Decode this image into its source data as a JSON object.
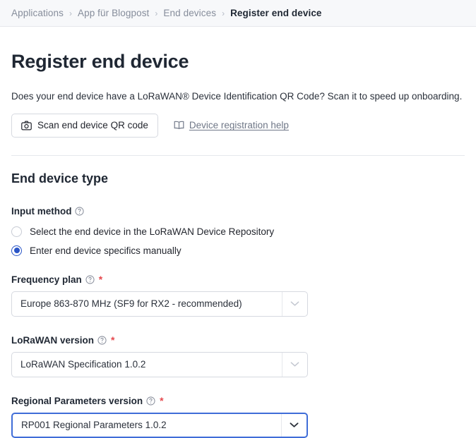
{
  "breadcrumb": {
    "separator": "›",
    "items": [
      {
        "label": "Applications",
        "active": false
      },
      {
        "label": "App für Blogpost",
        "active": false
      },
      {
        "label": "End devices",
        "active": false
      },
      {
        "label": "Register end device",
        "active": true
      }
    ]
  },
  "page": {
    "title": "Register end device",
    "description": "Does your end device have a LoRaWAN® Device Identification QR Code? Scan it to speed up onboarding."
  },
  "actions": {
    "scan_button_label": "Scan end device QR code",
    "scan_button_icon": "camera-icon",
    "help_link_label": "Device registration help",
    "help_link_icon": "book-icon"
  },
  "section": {
    "title": "End device type",
    "input_method": {
      "label": "Input method",
      "help_icon": "question-circle-icon",
      "options": [
        {
          "label": "Select the end device in the LoRaWAN Device Repository",
          "selected": false
        },
        {
          "label": "Enter end device specifics manually",
          "selected": true
        }
      ]
    },
    "fields": [
      {
        "label": "Frequency plan",
        "required_marker": "*",
        "help_icon": "question-circle-icon",
        "value": "Europe 863-870 MHz (SF9 for RX2 - recommended)",
        "focused": false,
        "arrow_icon": "chevron-down-icon"
      },
      {
        "label": "LoRaWAN version",
        "required_marker": "*",
        "help_icon": "question-circle-icon",
        "value": "LoRaWAN Specification 1.0.2",
        "focused": false,
        "arrow_icon": "chevron-down-icon"
      },
      {
        "label": "Regional Parameters version",
        "required_marker": "*",
        "help_icon": "question-circle-icon",
        "value": "RP001 Regional Parameters 1.0.2",
        "focused": true,
        "arrow_icon": "chevron-down-icon"
      }
    ]
  },
  "colors": {
    "accent_blue": "#2a55c7",
    "focus_blue": "#3f6dd8",
    "required_red": "#e5484d",
    "text_dark": "#1f2733",
    "text_muted": "#868d9b",
    "border": "#d6d9e0",
    "bar_bg": "#f7f8fa"
  }
}
